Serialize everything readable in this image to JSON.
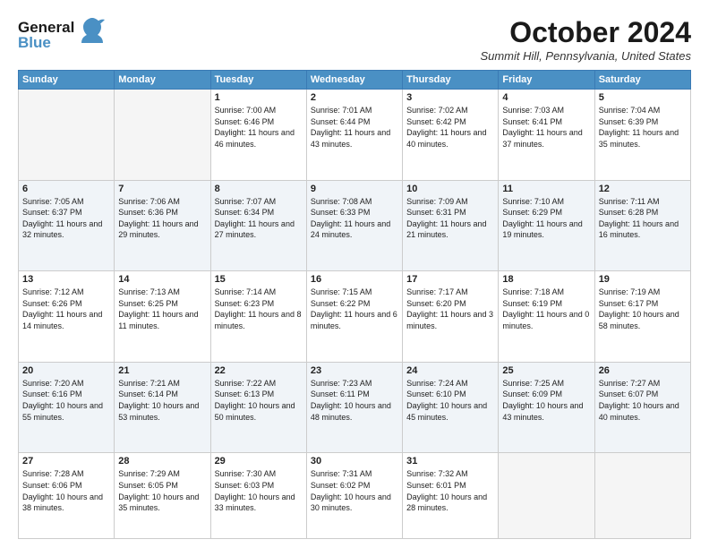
{
  "header": {
    "logo_general": "General",
    "logo_blue": "Blue",
    "month_title": "October 2024",
    "location": "Summit Hill, Pennsylvania, United States"
  },
  "days_of_week": [
    "Sunday",
    "Monday",
    "Tuesday",
    "Wednesday",
    "Thursday",
    "Friday",
    "Saturday"
  ],
  "weeks": [
    [
      {
        "day": "",
        "sunrise": "",
        "sunset": "",
        "daylight": "",
        "empty": true
      },
      {
        "day": "",
        "sunrise": "",
        "sunset": "",
        "daylight": "",
        "empty": true
      },
      {
        "day": "1",
        "sunrise": "Sunrise: 7:00 AM",
        "sunset": "Sunset: 6:46 PM",
        "daylight": "Daylight: 11 hours and 46 minutes."
      },
      {
        "day": "2",
        "sunrise": "Sunrise: 7:01 AM",
        "sunset": "Sunset: 6:44 PM",
        "daylight": "Daylight: 11 hours and 43 minutes."
      },
      {
        "day": "3",
        "sunrise": "Sunrise: 7:02 AM",
        "sunset": "Sunset: 6:42 PM",
        "daylight": "Daylight: 11 hours and 40 minutes."
      },
      {
        "day": "4",
        "sunrise": "Sunrise: 7:03 AM",
        "sunset": "Sunset: 6:41 PM",
        "daylight": "Daylight: 11 hours and 37 minutes."
      },
      {
        "day": "5",
        "sunrise": "Sunrise: 7:04 AM",
        "sunset": "Sunset: 6:39 PM",
        "daylight": "Daylight: 11 hours and 35 minutes."
      }
    ],
    [
      {
        "day": "6",
        "sunrise": "Sunrise: 7:05 AM",
        "sunset": "Sunset: 6:37 PM",
        "daylight": "Daylight: 11 hours and 32 minutes."
      },
      {
        "day": "7",
        "sunrise": "Sunrise: 7:06 AM",
        "sunset": "Sunset: 6:36 PM",
        "daylight": "Daylight: 11 hours and 29 minutes."
      },
      {
        "day": "8",
        "sunrise": "Sunrise: 7:07 AM",
        "sunset": "Sunset: 6:34 PM",
        "daylight": "Daylight: 11 hours and 27 minutes."
      },
      {
        "day": "9",
        "sunrise": "Sunrise: 7:08 AM",
        "sunset": "Sunset: 6:33 PM",
        "daylight": "Daylight: 11 hours and 24 minutes."
      },
      {
        "day": "10",
        "sunrise": "Sunrise: 7:09 AM",
        "sunset": "Sunset: 6:31 PM",
        "daylight": "Daylight: 11 hours and 21 minutes."
      },
      {
        "day": "11",
        "sunrise": "Sunrise: 7:10 AM",
        "sunset": "Sunset: 6:29 PM",
        "daylight": "Daylight: 11 hours and 19 minutes."
      },
      {
        "day": "12",
        "sunrise": "Sunrise: 7:11 AM",
        "sunset": "Sunset: 6:28 PM",
        "daylight": "Daylight: 11 hours and 16 minutes."
      }
    ],
    [
      {
        "day": "13",
        "sunrise": "Sunrise: 7:12 AM",
        "sunset": "Sunset: 6:26 PM",
        "daylight": "Daylight: 11 hours and 14 minutes."
      },
      {
        "day": "14",
        "sunrise": "Sunrise: 7:13 AM",
        "sunset": "Sunset: 6:25 PM",
        "daylight": "Daylight: 11 hours and 11 minutes."
      },
      {
        "day": "15",
        "sunrise": "Sunrise: 7:14 AM",
        "sunset": "Sunset: 6:23 PM",
        "daylight": "Daylight: 11 hours and 8 minutes."
      },
      {
        "day": "16",
        "sunrise": "Sunrise: 7:15 AM",
        "sunset": "Sunset: 6:22 PM",
        "daylight": "Daylight: 11 hours and 6 minutes."
      },
      {
        "day": "17",
        "sunrise": "Sunrise: 7:17 AM",
        "sunset": "Sunset: 6:20 PM",
        "daylight": "Daylight: 11 hours and 3 minutes."
      },
      {
        "day": "18",
        "sunrise": "Sunrise: 7:18 AM",
        "sunset": "Sunset: 6:19 PM",
        "daylight": "Daylight: 11 hours and 0 minutes."
      },
      {
        "day": "19",
        "sunrise": "Sunrise: 7:19 AM",
        "sunset": "Sunset: 6:17 PM",
        "daylight": "Daylight: 10 hours and 58 minutes."
      }
    ],
    [
      {
        "day": "20",
        "sunrise": "Sunrise: 7:20 AM",
        "sunset": "Sunset: 6:16 PM",
        "daylight": "Daylight: 10 hours and 55 minutes."
      },
      {
        "day": "21",
        "sunrise": "Sunrise: 7:21 AM",
        "sunset": "Sunset: 6:14 PM",
        "daylight": "Daylight: 10 hours and 53 minutes."
      },
      {
        "day": "22",
        "sunrise": "Sunrise: 7:22 AM",
        "sunset": "Sunset: 6:13 PM",
        "daylight": "Daylight: 10 hours and 50 minutes."
      },
      {
        "day": "23",
        "sunrise": "Sunrise: 7:23 AM",
        "sunset": "Sunset: 6:11 PM",
        "daylight": "Daylight: 10 hours and 48 minutes."
      },
      {
        "day": "24",
        "sunrise": "Sunrise: 7:24 AM",
        "sunset": "Sunset: 6:10 PM",
        "daylight": "Daylight: 10 hours and 45 minutes."
      },
      {
        "day": "25",
        "sunrise": "Sunrise: 7:25 AM",
        "sunset": "Sunset: 6:09 PM",
        "daylight": "Daylight: 10 hours and 43 minutes."
      },
      {
        "day": "26",
        "sunrise": "Sunrise: 7:27 AM",
        "sunset": "Sunset: 6:07 PM",
        "daylight": "Daylight: 10 hours and 40 minutes."
      }
    ],
    [
      {
        "day": "27",
        "sunrise": "Sunrise: 7:28 AM",
        "sunset": "Sunset: 6:06 PM",
        "daylight": "Daylight: 10 hours and 38 minutes."
      },
      {
        "day": "28",
        "sunrise": "Sunrise: 7:29 AM",
        "sunset": "Sunset: 6:05 PM",
        "daylight": "Daylight: 10 hours and 35 minutes."
      },
      {
        "day": "29",
        "sunrise": "Sunrise: 7:30 AM",
        "sunset": "Sunset: 6:03 PM",
        "daylight": "Daylight: 10 hours and 33 minutes."
      },
      {
        "day": "30",
        "sunrise": "Sunrise: 7:31 AM",
        "sunset": "Sunset: 6:02 PM",
        "daylight": "Daylight: 10 hours and 30 minutes."
      },
      {
        "day": "31",
        "sunrise": "Sunrise: 7:32 AM",
        "sunset": "Sunset: 6:01 PM",
        "daylight": "Daylight: 10 hours and 28 minutes."
      },
      {
        "day": "",
        "sunrise": "",
        "sunset": "",
        "daylight": "",
        "empty": true
      },
      {
        "day": "",
        "sunrise": "",
        "sunset": "",
        "daylight": "",
        "empty": true
      }
    ]
  ]
}
